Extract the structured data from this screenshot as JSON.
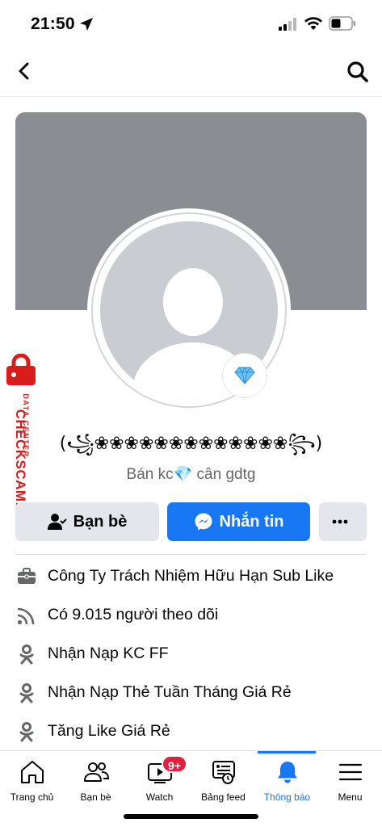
{
  "status_bar": {
    "time": "21:50"
  },
  "profile": {
    "name": "(꧁❀❀❀❀❀❀❀❀❀❀❀❀❀꧂)",
    "bio": "Bán kc💎 cân gdtg",
    "badge_icon": "diamond-icon"
  },
  "watermark": {
    "main": "CHECKSCAM.INFO",
    "sub": "DATA CENTER"
  },
  "actions": {
    "friends_label": "Bạn bè",
    "message_label": "Nhắn tin",
    "more_label": "···"
  },
  "info": [
    {
      "icon": "briefcase-icon",
      "text": "Công Ty Trách Nhiệm Hữu Hạn Sub Like"
    },
    {
      "icon": "followers-icon",
      "text": "Có 9.015 người theo dõi"
    },
    {
      "icon": "ok-icon",
      "text": "Nhận Nạp KC FF"
    },
    {
      "icon": "ok-icon",
      "text": "Nhận Nạp Thẻ Tuần Tháng Giá Rẻ"
    },
    {
      "icon": "ok-icon",
      "text": "Tăng Like Giá Rẻ"
    }
  ],
  "tabs": [
    {
      "label": "Trang chủ",
      "icon": "home-icon"
    },
    {
      "label": "Bạn bè",
      "icon": "friends-icon"
    },
    {
      "label": "Watch",
      "icon": "watch-icon",
      "badge": "9+"
    },
    {
      "label": "Bảng feed",
      "icon": "feed-icon"
    },
    {
      "label": "Thông báo",
      "icon": "bell-icon",
      "active": true
    },
    {
      "label": "Menu",
      "icon": "menu-icon"
    }
  ],
  "colors": {
    "accent": "#1877f2",
    "badge_red": "#e41e3f",
    "watermark_red": "#d91c1c",
    "cover_gray": "#8a8d91"
  }
}
